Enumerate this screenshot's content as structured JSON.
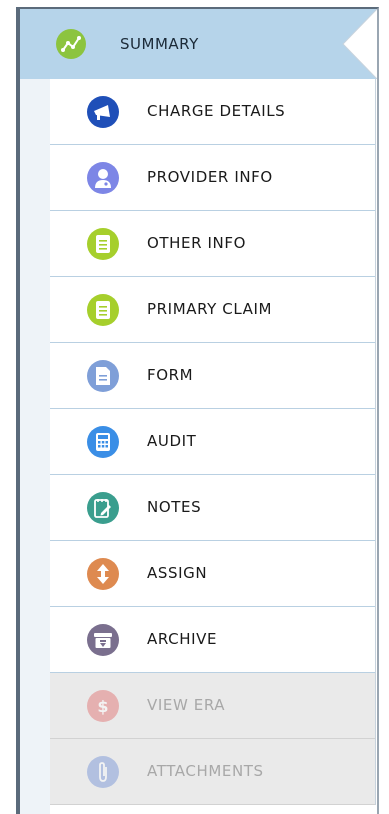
{
  "header": {
    "label": "SUMMARY",
    "icon": "trend-icon",
    "color": "#8cc43f"
  },
  "menu": {
    "items": [
      {
        "label": "CHARGE DETAILS",
        "icon": "megaphone-icon",
        "color": "#1f4fb8",
        "enabled": true
      },
      {
        "label": "PROVIDER INFO",
        "icon": "doctor-icon",
        "color": "#7d86e6",
        "enabled": true
      },
      {
        "label": "OTHER INFO",
        "icon": "document-icon",
        "color": "#a6cf2c",
        "enabled": true
      },
      {
        "label": "PRIMARY CLAIM",
        "icon": "document-icon",
        "color": "#a6cf2c",
        "enabled": true
      },
      {
        "label": "FORM",
        "icon": "form-icon",
        "color": "#7f9fd8",
        "enabled": true
      },
      {
        "label": "AUDIT",
        "icon": "calculator-icon",
        "color": "#3a8ee6",
        "enabled": true
      },
      {
        "label": "NOTES",
        "icon": "notes-icon",
        "color": "#3a9e8e",
        "enabled": true
      },
      {
        "label": "ASSIGN",
        "icon": "arrows-icon",
        "color": "#de8a50",
        "enabled": true
      },
      {
        "label": "ARCHIVE",
        "icon": "archive-icon",
        "color": "#7a6f8e",
        "enabled": true
      },
      {
        "label": "VIEW ERA",
        "icon": "dollar-icon",
        "color": "#e6a0a0",
        "enabled": false
      },
      {
        "label": "ATTACHMENTS",
        "icon": "paperclip-icon",
        "color": "#9fb4e0",
        "enabled": false
      }
    ]
  }
}
